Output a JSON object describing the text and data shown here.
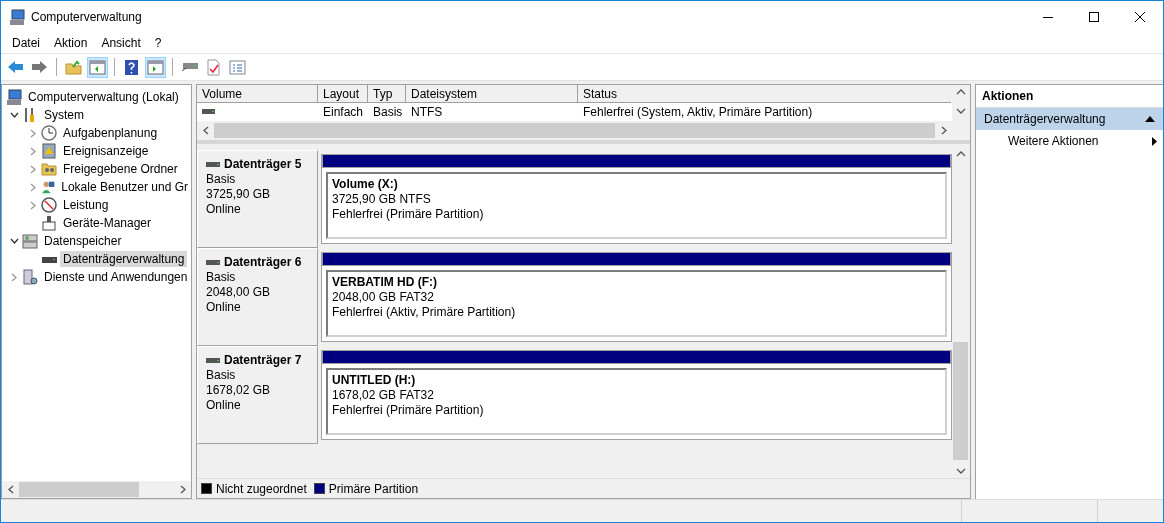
{
  "window": {
    "title": "Computerverwaltung"
  },
  "menu": [
    "Datei",
    "Aktion",
    "Ansicht",
    "?"
  ],
  "tree": [
    {
      "label": "Computerverwaltung (Lokal)",
      "selected": false,
      "children": [
        {
          "label": "System",
          "selected": false,
          "expanded": true,
          "children": [
            {
              "label": "Aufgabenplanung",
              "selected": false,
              "expanded": false
            },
            {
              "label": "Ereignisanzeige",
              "selected": false,
              "expanded": false
            },
            {
              "label": "Freigegebene Ordner",
              "selected": false,
              "expanded": false
            },
            {
              "label": "Lokale Benutzer und Gr",
              "selected": false,
              "expanded": false
            },
            {
              "label": "Leistung",
              "selected": false,
              "expanded": false
            },
            {
              "label": "Geräte-Manager",
              "selected": false
            }
          ]
        },
        {
          "label": "Datenspeicher",
          "selected": false,
          "expanded": true,
          "children": [
            {
              "label": "Datenträgerverwaltung",
              "selected": true
            }
          ]
        },
        {
          "label": "Dienste und Anwendungen",
          "selected": false,
          "expanded": false
        }
      ]
    }
  ],
  "volume_table": {
    "columns": [
      "Volume",
      "Layout",
      "Typ",
      "Dateisystem",
      "Status"
    ],
    "rows": [
      [
        "",
        "Einfach",
        "Basis",
        "NTFS",
        "Fehlerfrei (System, Aktiv, Primäre Partition)"
      ]
    ]
  },
  "disks": [
    {
      "name": "Datenträger 5",
      "type": "Basis",
      "size": "3725,90 GB",
      "state": "Online",
      "partition": {
        "label": "Volume  (X:)",
        "size": "3725,90 GB NTFS",
        "status": "Fehlerfrei (Primäre Partition)",
        "color": "#000080"
      }
    },
    {
      "name": "Datenträger 6",
      "type": "Basis",
      "size": "2048,00 GB",
      "state": "Online",
      "partition": {
        "label": "VERBATIM HD  (F:)",
        "size": "2048,00 GB FAT32",
        "status": "Fehlerfrei (Aktiv, Primäre Partition)",
        "color": "#000080"
      }
    },
    {
      "name": "Datenträger 7",
      "type": "Basis",
      "size": "1678,02 GB",
      "state": "Online",
      "partition": {
        "label": "UNTITLED  (H:)",
        "size": "1678,02 GB FAT32",
        "status": "Fehlerfrei (Primäre Partition)",
        "color": "#000080"
      }
    }
  ],
  "legend": [
    {
      "label": "Nicht zugeordnet",
      "color": "#000000"
    },
    {
      "label": "Primäre Partition",
      "color": "#000080"
    }
  ],
  "actions": {
    "title": "Aktionen",
    "sections": [
      {
        "label": "Datenträgerverwaltung",
        "expanded": true,
        "items": [
          "Weitere Aktionen"
        ]
      }
    ]
  }
}
